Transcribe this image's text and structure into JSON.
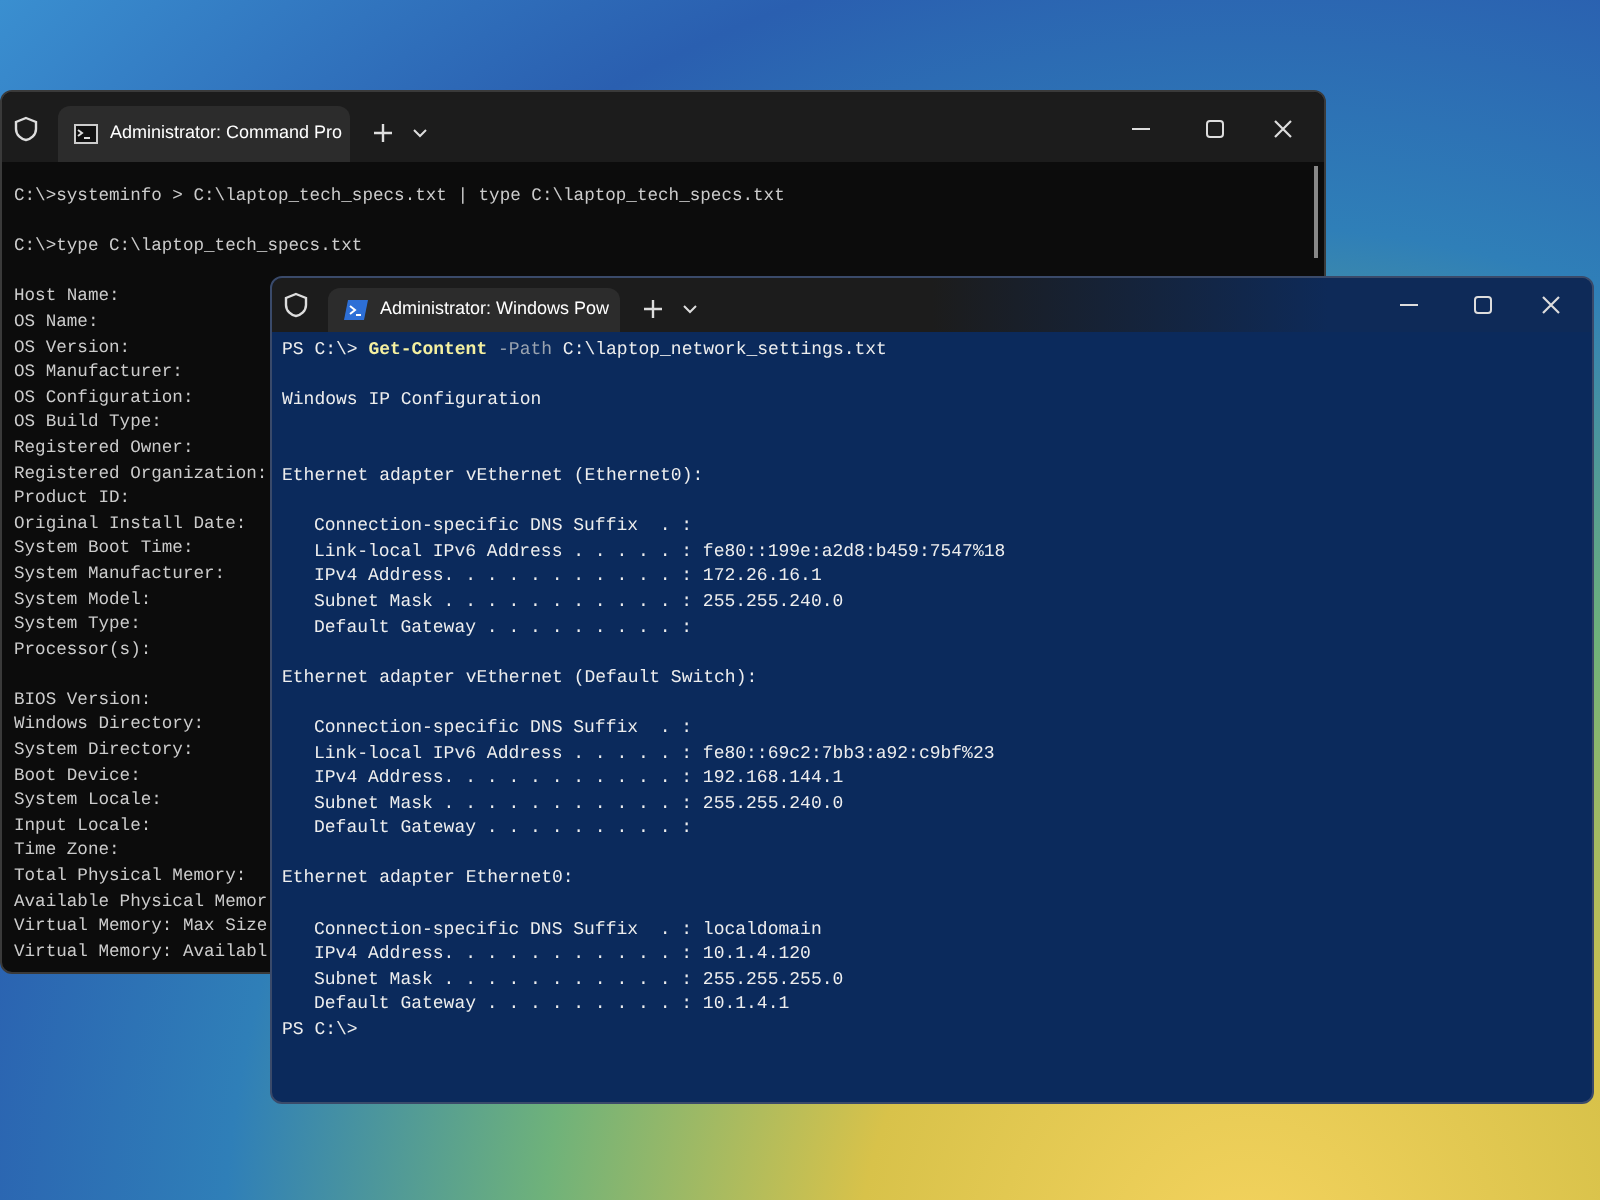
{
  "cmd_window": {
    "tab_title": "Administrator: Command Pro",
    "lines": [
      {
        "kind": "text",
        "text": "C:\\>systeminfo > C:\\laptop_tech_specs.txt | type C:\\laptop_tech_specs.txt"
      },
      {
        "kind": "blank"
      },
      {
        "kind": "text",
        "text": "C:\\>type C:\\laptop_tech_specs.txt"
      },
      {
        "kind": "blank"
      },
      {
        "kind": "text",
        "text": "Host Name:"
      },
      {
        "kind": "text",
        "text": "OS Name:"
      },
      {
        "kind": "text",
        "text": "OS Version:"
      },
      {
        "kind": "text",
        "text": "OS Manufacturer:"
      },
      {
        "kind": "text",
        "text": "OS Configuration:"
      },
      {
        "kind": "text",
        "text": "OS Build Type:"
      },
      {
        "kind": "text",
        "text": "Registered Owner:"
      },
      {
        "kind": "text",
        "text": "Registered Organization:"
      },
      {
        "kind": "text",
        "text": "Product ID:"
      },
      {
        "kind": "text",
        "text": "Original Install Date:"
      },
      {
        "kind": "text",
        "text": "System Boot Time:"
      },
      {
        "kind": "text",
        "text": "System Manufacturer:"
      },
      {
        "kind": "text",
        "text": "System Model:"
      },
      {
        "kind": "text",
        "text": "System Type:"
      },
      {
        "kind": "text",
        "text": "Processor(s):"
      },
      {
        "kind": "blank"
      },
      {
        "kind": "text",
        "text": "BIOS Version:"
      },
      {
        "kind": "text",
        "text": "Windows Directory:"
      },
      {
        "kind": "text",
        "text": "System Directory:"
      },
      {
        "kind": "text",
        "text": "Boot Device:"
      },
      {
        "kind": "text",
        "text": "System Locale:"
      },
      {
        "kind": "text",
        "text": "Input Locale:"
      },
      {
        "kind": "text",
        "text": "Time Zone:"
      },
      {
        "kind": "text",
        "text": "Total Physical Memory:"
      },
      {
        "kind": "text",
        "text": "Available Physical Memor"
      },
      {
        "kind": "text",
        "text": "Virtual Memory: Max Size"
      },
      {
        "kind": "text",
        "text": "Virtual Memory: Availabl"
      }
    ]
  },
  "ps_window": {
    "tab_title": "Administrator: Windows Pow",
    "lines": [
      {
        "kind": "command",
        "prompt": "PS C:\\>",
        "cmdlet": "Get-Content",
        "parameter": "-Path",
        "argument": "C:\\laptop_network_settings.txt"
      },
      {
        "kind": "blank"
      },
      {
        "kind": "text",
        "text": "Windows IP Configuration"
      },
      {
        "kind": "blank"
      },
      {
        "kind": "blank"
      },
      {
        "kind": "text",
        "text": "Ethernet adapter vEthernet (Ethernet0):"
      },
      {
        "kind": "blank"
      },
      {
        "kind": "field",
        "text": "Connection-specific DNS Suffix  . :"
      },
      {
        "kind": "field",
        "text": "Link-local IPv6 Address . . . . . : fe80::199e:a2d8:b459:7547%18"
      },
      {
        "kind": "field",
        "text": "IPv4 Address. . . . . . . . . . . : 172.26.16.1"
      },
      {
        "kind": "field",
        "text": "Subnet Mask . . . . . . . . . . . : 255.255.240.0"
      },
      {
        "kind": "field",
        "text": "Default Gateway . . . . . . . . . :"
      },
      {
        "kind": "blank"
      },
      {
        "kind": "text",
        "text": "Ethernet adapter vEthernet (Default Switch):"
      },
      {
        "kind": "blank"
      },
      {
        "kind": "field",
        "text": "Connection-specific DNS Suffix  . :"
      },
      {
        "kind": "field",
        "text": "Link-local IPv6 Address . . . . . : fe80::69c2:7bb3:a92:c9bf%23"
      },
      {
        "kind": "field",
        "text": "IPv4 Address. . . . . . . . . . . : 192.168.144.1"
      },
      {
        "kind": "field",
        "text": "Subnet Mask . . . . . . . . . . . : 255.255.240.0"
      },
      {
        "kind": "field",
        "text": "Default Gateway . . . . . . . . . :"
      },
      {
        "kind": "blank"
      },
      {
        "kind": "text",
        "text": "Ethernet adapter Ethernet0:"
      },
      {
        "kind": "blank"
      },
      {
        "kind": "field",
        "text": "Connection-specific DNS Suffix  . : localdomain"
      },
      {
        "kind": "field",
        "text": "IPv4 Address. . . . . . . . . . . : 10.1.4.120"
      },
      {
        "kind": "field",
        "text": "Subnet Mask . . . . . . . . . . . : 255.255.255.0"
      },
      {
        "kind": "field",
        "text": "Default Gateway . . . . . . . . . : 10.1.4.1"
      },
      {
        "kind": "text",
        "text": "PS C:\\>"
      }
    ]
  }
}
